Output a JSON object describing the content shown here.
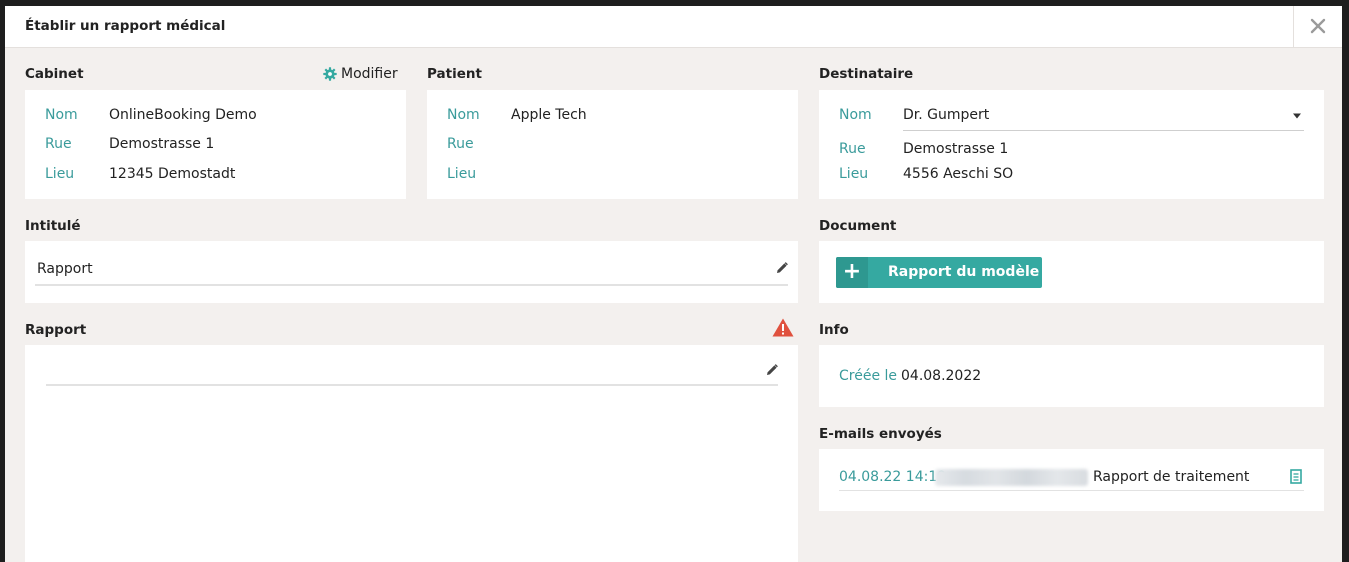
{
  "dialog": {
    "title": "Établir un rapport médical",
    "close_icon": "close-icon"
  },
  "cabinet": {
    "heading": "Cabinet",
    "modify_label": "Modifier",
    "fields": [
      {
        "key": "Nom",
        "value": "OnlineBooking Demo"
      },
      {
        "key": "Rue",
        "value": "Demostrasse 1"
      },
      {
        "key": "Lieu",
        "value": "12345 Demostadt"
      }
    ]
  },
  "patient": {
    "heading": "Patient",
    "fields": [
      {
        "key": "Nom",
        "value": "Apple Tech"
      },
      {
        "key": "Rue",
        "value": ""
      },
      {
        "key": "Lieu",
        "value": ""
      }
    ]
  },
  "destinataire": {
    "heading": "Destinataire",
    "fields": [
      {
        "key": "Nom",
        "value": "Dr. Gumpert"
      },
      {
        "key": "Rue",
        "value": "Demostrasse 1"
      },
      {
        "key": "Lieu",
        "value": "4556 Aeschi SO"
      }
    ]
  },
  "intitule": {
    "heading": "Intitulé",
    "value": "Rapport"
  },
  "document": {
    "heading": "Document",
    "button_label": "Rapport du modèle",
    "button_icon": "+"
  },
  "rapport": {
    "heading": "Rapport",
    "value": ""
  },
  "info": {
    "heading": "Info",
    "created_key": "Créée le",
    "created_value": "04.08.2022"
  },
  "emails": {
    "heading": "E-mails envoyés",
    "items": [
      {
        "timestamp": "04.08.22 14:19",
        "subject": "Rapport de traitement"
      }
    ]
  },
  "colors": {
    "accent": "#35a9a1",
    "label_teal": "#3a9b9b",
    "warning": "#e0513e",
    "background": "#f3f0ee"
  }
}
